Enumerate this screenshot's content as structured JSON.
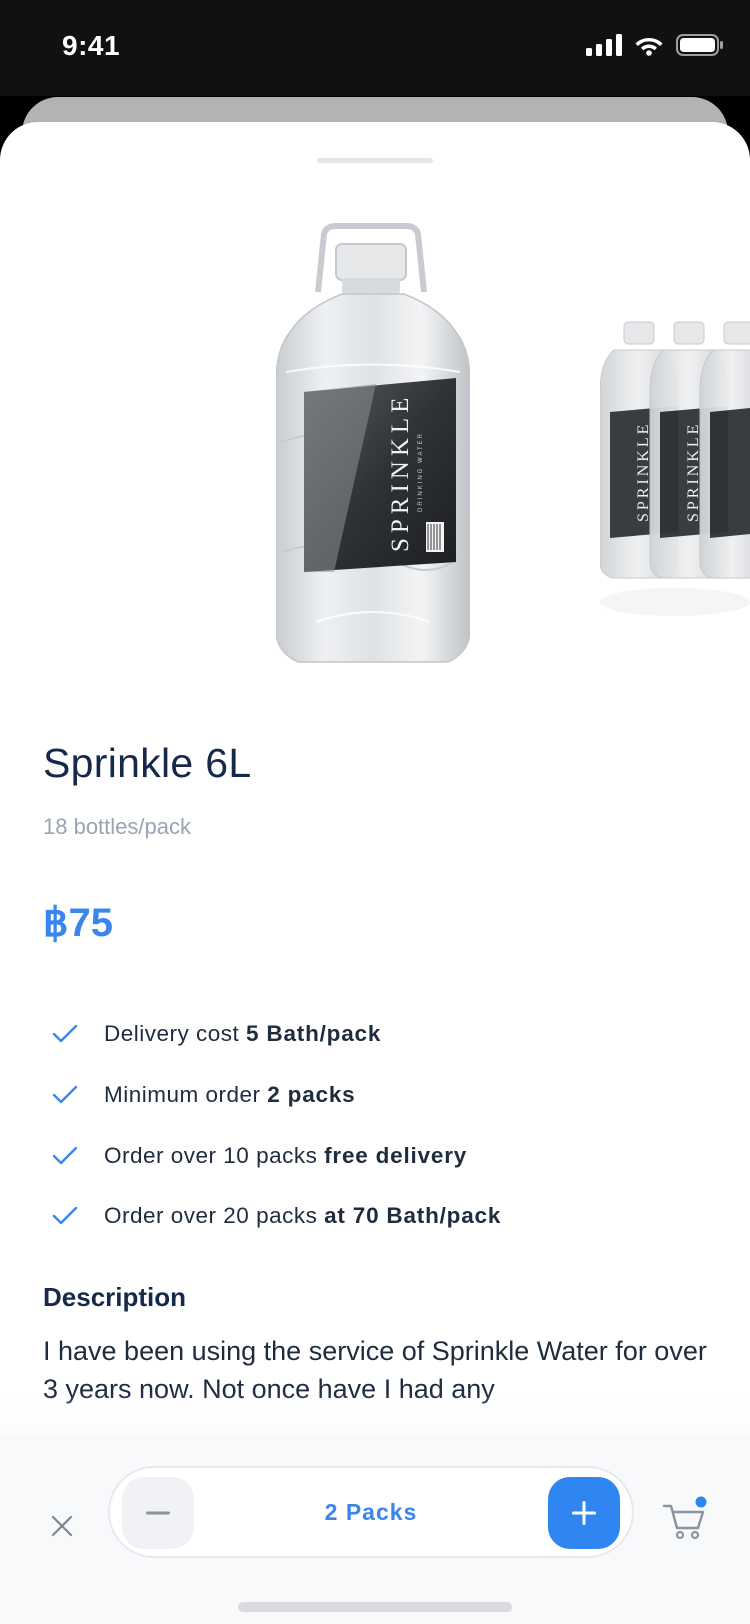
{
  "status_bar": {
    "time": "9:41"
  },
  "product": {
    "name": "Sprinkle 6L",
    "subtitle": "18 bottles/pack",
    "price": "฿75",
    "bottle_brand": "SPRINKLE",
    "bottle_tagline": "DRINKING WATER"
  },
  "features": [
    {
      "prefix": "Delivery cost ",
      "highlight": "5 Bath/pack"
    },
    {
      "prefix": "Minimum order ",
      "highlight": "2 packs"
    },
    {
      "prefix": "Order over 10 packs ",
      "highlight": "free delivery"
    },
    {
      "prefix": "Order over 20 packs ",
      "highlight": "at 70 Bath/pack"
    }
  ],
  "description": {
    "heading": "Description",
    "text": "I have been using the service of Sprinkle Water for over 3 years now. Not once have I had any"
  },
  "cart_bar": {
    "quantity_label": "2 Packs",
    "cart_badge": true
  },
  "colors": {
    "accent": "#3b86ee",
    "title": "#17294a",
    "muted": "#9aa4b2"
  },
  "icons": [
    "signal-icon",
    "wifi-icon",
    "battery-icon",
    "check-icon",
    "close-icon",
    "minus-icon",
    "plus-icon",
    "cart-icon"
  ]
}
